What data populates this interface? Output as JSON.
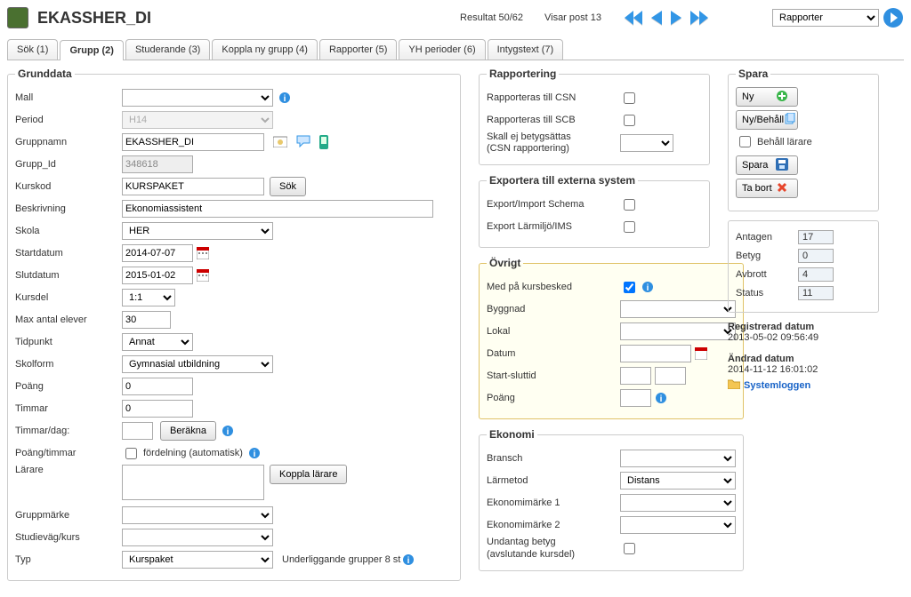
{
  "header": {
    "title": "EKASSHER_DI",
    "result": "Resultat 50/62",
    "showing": "Visar post 13",
    "reports_selected": "Rapporter"
  },
  "tabs": [
    {
      "label": "Sök (1)"
    },
    {
      "label": "Grupp (2)"
    },
    {
      "label": "Studerande (3)"
    },
    {
      "label": "Koppla ny grupp (4)"
    },
    {
      "label": "Rapporter (5)"
    },
    {
      "label": "YH perioder (6)"
    },
    {
      "label": "Intygstext (7)"
    }
  ],
  "grunddata": {
    "legend": "Grunddata",
    "mall_label": "Mall",
    "mall_value": "",
    "period_label": "Period",
    "period_value": "H14",
    "gruppnamn_label": "Gruppnamn",
    "gruppnamn_value": "EKASSHER_DI",
    "gruppid_label": "Grupp_Id",
    "gruppid_value": "348618",
    "kurskod_label": "Kurskod",
    "kurskod_value": "KURSPAKET",
    "sok_btn": "Sök",
    "beskrivning_label": "Beskrivning",
    "beskrivning_value": "Ekonomiassistent",
    "skola_label": "Skola",
    "skola_value": "HER",
    "startdatum_label": "Startdatum",
    "startdatum_value": "2014-07-07",
    "slutdatum_label": "Slutdatum",
    "slutdatum_value": "2015-01-02",
    "kursdel_label": "Kursdel",
    "kursdel_value": "1:1",
    "maxelever_label": "Max antal elever",
    "maxelever_value": "30",
    "tidpunkt_label": "Tidpunkt",
    "tidpunkt_value": "Annat",
    "skolform_label": "Skolform",
    "skolform_value": "Gymnasial utbildning",
    "poang_label": "Poäng",
    "poang_value": "0",
    "timmar_label": "Timmar",
    "timmar_value": "0",
    "timmar_dag_label": "Timmar/dag:",
    "berakna_btn": "Beräkna",
    "poang_timmar_label": "Poäng/timmar",
    "fordelning_label": "fördelning (automatisk)",
    "larare_label": "Lärare",
    "koppla_larare_btn": "Koppla lärare",
    "gruppmarke_label": "Gruppmärke",
    "studievag_label": "Studieväg/kurs",
    "typ_label": "Typ",
    "typ_value": "Kurspaket",
    "underliggande": "Underliggande grupper 8 st"
  },
  "rapportering": {
    "legend": "Rapportering",
    "csn_label": "Rapporteras till CSN",
    "scb_label": "Rapporteras till SCB",
    "skall_label": "Skall ej betygsättas\n(CSN rapportering)"
  },
  "exportera": {
    "legend": "Exportera till externa system",
    "schema_label": "Export/Import Schema",
    "larmiljo_label": "Export Lärmiljö/IMS"
  },
  "ovrigt": {
    "legend": "Övrigt",
    "kursbesked_label": "Med på kursbesked",
    "byggnad_label": "Byggnad",
    "lokal_label": "Lokal",
    "datum_label": "Datum",
    "startslut_label": "Start-sluttid",
    "poang_label": "Poäng"
  },
  "ekonomi": {
    "legend": "Ekonomi",
    "bransch_label": "Bransch",
    "larmetod_label": "Lärmetod",
    "larmetod_value": "Distans",
    "ekomarke1_label": "Ekonomimärke 1",
    "ekomarke2_label": "Ekonomimärke 2",
    "undantag_label": "Undantag betyg\n(avslutande kursdel)"
  },
  "spara": {
    "legend": "Spara",
    "ny_btn": "Ny",
    "nybehall_btn": "Ny/Behåll",
    "behall_larare": "Behåll lärare",
    "spara_btn": "Spara",
    "tabort_btn": "Ta bort"
  },
  "stats": {
    "antagen_label": "Antagen",
    "antagen_value": "17",
    "betyg_label": "Betyg",
    "betyg_value": "0",
    "avbrott_label": "Avbrott",
    "avbrott_value": "4",
    "status_label": "Status",
    "status_value": "11"
  },
  "registered": {
    "reg_label": "Registrerad datum",
    "reg_value": "2013-05-02 09:56:49",
    "changed_label": "Ändrad datum",
    "changed_value": "2014-11-12 16:01:02",
    "syslog": "Systemloggen"
  }
}
